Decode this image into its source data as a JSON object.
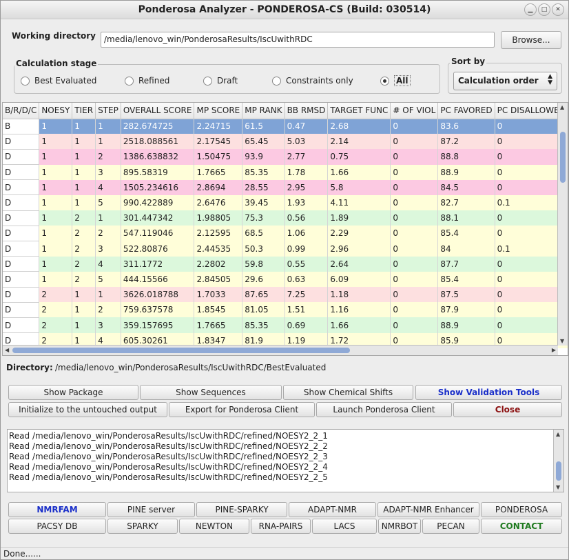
{
  "window": {
    "title": "Ponderosa Analyzer - PONDEROSA-CS (Build: 030514)"
  },
  "working_directory": {
    "label": "Working directory",
    "value": "/media/lenovo_win/PonderosaResults/IscUwithRDC",
    "browse_label": "Browse..."
  },
  "calc_stage": {
    "title": "Calculation stage",
    "options": [
      "Best Evaluated",
      "Refined",
      "Draft",
      "Constraints only",
      "All"
    ],
    "selected": "All"
  },
  "sort_by": {
    "title": "Sort by",
    "value": "Calculation order"
  },
  "table": {
    "headers": [
      "B/R/D/C",
      "NOESY",
      "TIER",
      "STEP",
      "OVERALL SCORE",
      "MP SCORE",
      "MP RANK",
      "BB RMSD",
      "TARGET FUNC",
      "# OF VIOL",
      "PC FAVORED",
      "PC DISALLOWED"
    ],
    "rows": [
      [
        "B",
        "1",
        "1",
        "1",
        "282.674725",
        "2.24715",
        "61.5",
        "0.47",
        "2.68",
        "0",
        "83.6",
        "0"
      ],
      [
        "D",
        "1",
        "1",
        "1",
        "2518.088561",
        "2.17545",
        "65.45",
        "5.03",
        "2.14",
        "0",
        "87.2",
        "0"
      ],
      [
        "D",
        "1",
        "1",
        "2",
        "1386.638832",
        "1.50475",
        "93.9",
        "2.77",
        "0.75",
        "0",
        "88.8",
        "0"
      ],
      [
        "D",
        "1",
        "1",
        "3",
        "895.58319",
        "1.7665",
        "85.35",
        "1.78",
        "1.66",
        "0",
        "88.9",
        "0"
      ],
      [
        "D",
        "1",
        "1",
        "4",
        "1505.234616",
        "2.8694",
        "28.55",
        "2.95",
        "5.8",
        "0",
        "84.5",
        "0"
      ],
      [
        "D",
        "1",
        "1",
        "5",
        "990.422889",
        "2.6476",
        "39.45",
        "1.93",
        "4.11",
        "0",
        "82.7",
        "0.1"
      ],
      [
        "D",
        "1",
        "2",
        "1",
        "301.447342",
        "1.98805",
        "75.3",
        "0.56",
        "1.89",
        "0",
        "88.1",
        "0"
      ],
      [
        "D",
        "1",
        "2",
        "2",
        "547.119046",
        "2.12595",
        "68.5",
        "1.06",
        "2.29",
        "0",
        "85.4",
        "0"
      ],
      [
        "D",
        "1",
        "2",
        "3",
        "522.80876",
        "2.44535",
        "50.3",
        "0.99",
        "2.96",
        "0",
        "84",
        "0.1"
      ],
      [
        "D",
        "1",
        "2",
        "4",
        "311.1772",
        "2.2802",
        "59.8",
        "0.55",
        "2.64",
        "0",
        "87.7",
        "0"
      ],
      [
        "D",
        "1",
        "2",
        "5",
        "444.15566",
        "2.84505",
        "29.6",
        "0.63",
        "6.09",
        "0",
        "85.4",
        "0"
      ],
      [
        "D",
        "2",
        "1",
        "1",
        "3626.018788",
        "1.7033",
        "87.65",
        "7.25",
        "1.18",
        "0",
        "87.5",
        "0"
      ],
      [
        "D",
        "2",
        "1",
        "2",
        "759.637578",
        "1.8545",
        "81.05",
        "1.51",
        "1.16",
        "0",
        "87.9",
        "0"
      ],
      [
        "D",
        "2",
        "1",
        "3",
        "359.157695",
        "1.7665",
        "85.35",
        "0.69",
        "1.66",
        "0",
        "88.9",
        "0"
      ],
      [
        "D",
        "2",
        "1",
        "4",
        "605.30261",
        "1.8347",
        "81.9",
        "1.19",
        "1.72",
        "0",
        "85.9",
        "0"
      ]
    ],
    "row_colors": [
      "#7fa3d6",
      "#fde0e0",
      "#fcc9e2",
      "#fffed9",
      "#fcc9e2",
      "#fffed9",
      "#dcf8dc",
      "#fffed9",
      "#fffed9",
      "#dcf8dc",
      "#fffed9",
      "#fde0e0",
      "#fffed9",
      "#dcf8dc",
      "#fffed9"
    ]
  },
  "directory": {
    "label": "Directory:",
    "value": "/media/lenovo_win/PonderosaResults/IscUwithRDC/BestEvaluated"
  },
  "actions": {
    "show_package": "Show Package",
    "show_sequences": "Show Sequences",
    "show_chemical_shifts": "Show Chemical Shifts",
    "show_validation_tools": "Show Validation Tools",
    "initialize": "Initialize to the untouched output",
    "export": "Export for Ponderosa Client",
    "launch": "Launch Ponderosa Client",
    "close": "Close"
  },
  "log": [
    "Read /media/lenovo_win/PonderosaResults/IscUwithRDC/refined/NOESY2_2_1",
    "Read /media/lenovo_win/PonderosaResults/IscUwithRDC/refined/NOESY2_2_2",
    "Read /media/lenovo_win/PonderosaResults/IscUwithRDC/refined/NOESY2_2_3",
    "Read /media/lenovo_win/PonderosaResults/IscUwithRDC/refined/NOESY2_2_4",
    "Read /media/lenovo_win/PonderosaResults/IscUwithRDC/refined/NOESY2_2_5"
  ],
  "links_row1": [
    "NMRFAM",
    "PINE server",
    "PINE-SPARKY",
    "ADAPT-NMR",
    "ADAPT-NMR Enhancer",
    "PONDEROSA"
  ],
  "links_row2": [
    "PACSY DB",
    "SPARKY",
    "NEWTON",
    "RNA-PAIRS",
    "LACS",
    "NMRBOT",
    "PECAN",
    "CONTACT"
  ],
  "colors": {
    "nmrfam": "#1a2fc9",
    "validation": "#1a2fc9",
    "close": "#8b1010",
    "contact": "#1e7a1e",
    "selected_row": "#7fa3d6"
  },
  "status": "Done......"
}
